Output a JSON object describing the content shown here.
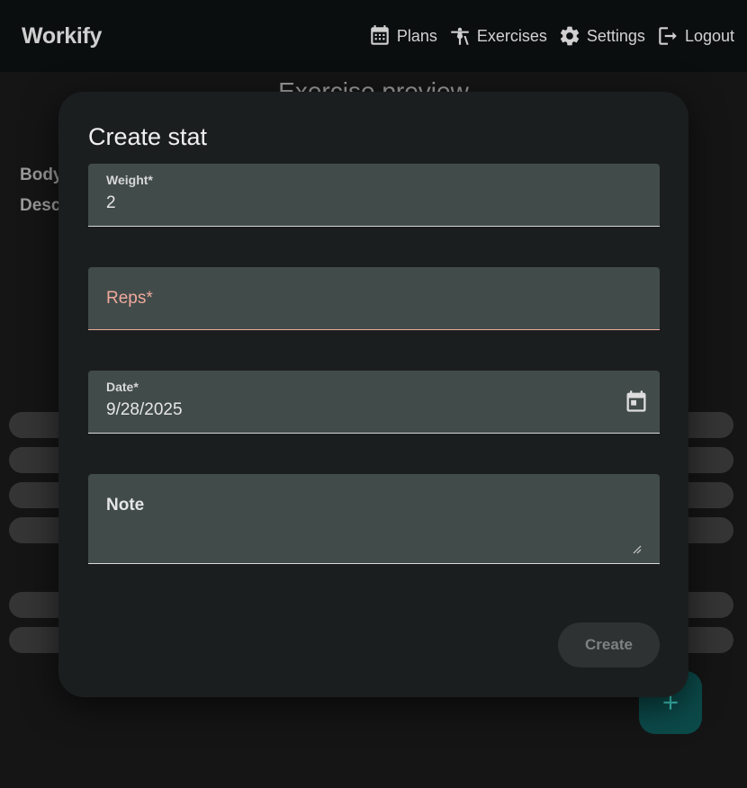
{
  "app": {
    "brand": "Workify",
    "nav": [
      {
        "label": "Plans",
        "icon": "calendar-icon"
      },
      {
        "label": "Exercises",
        "icon": "exercise-icon"
      },
      {
        "label": "Settings",
        "icon": "gear-icon"
      },
      {
        "label": "Logout",
        "icon": "logout-icon"
      }
    ]
  },
  "background": {
    "title": "Exercise preview",
    "labels": [
      "Body",
      "Desc"
    ],
    "fab_label": "+"
  },
  "dialog": {
    "title": "Create stat",
    "fields": {
      "weight": {
        "label": "Weight*",
        "value": "2"
      },
      "reps": {
        "label": "Reps*",
        "value": ""
      },
      "date": {
        "label": "Date*",
        "value": "9/28/2025"
      },
      "note": {
        "label": "Note",
        "value": ""
      }
    },
    "create_label": "Create"
  },
  "colors": {
    "accent": "#0c4a4a",
    "error": "#f0a99c",
    "field_bg": "#414b4a"
  }
}
